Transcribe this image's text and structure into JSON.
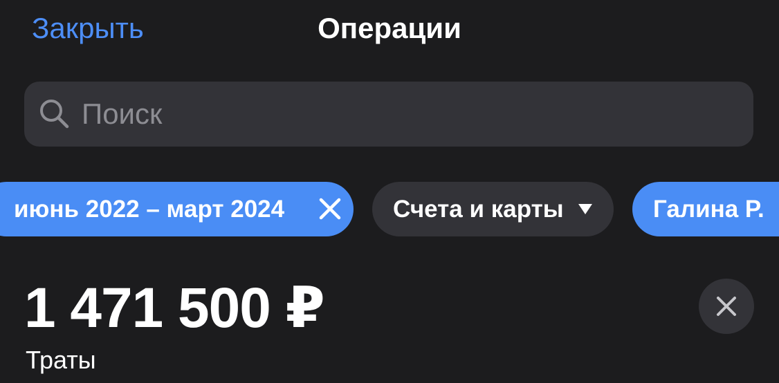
{
  "header": {
    "close_label": "Закрыть",
    "title": "Операции"
  },
  "search": {
    "placeholder": "Поиск",
    "value": "",
    "icon": "search-icon"
  },
  "filters": {
    "date_range": {
      "label": "июнь 2022 – март 2024",
      "clear_icon": "close-icon"
    },
    "accounts": {
      "label": "Счета и карты",
      "icon": "caret-down-icon"
    },
    "person": {
      "label": "Галина Р."
    }
  },
  "summary": {
    "amount": "1 471 500 ₽",
    "label": "Траты",
    "dismiss_icon": "close-icon"
  },
  "colors": {
    "background": "#1c1c1e",
    "accent": "#4a8df5",
    "link": "#4d8ef7",
    "control": "#333338",
    "placeholder": "#8d8d93"
  }
}
